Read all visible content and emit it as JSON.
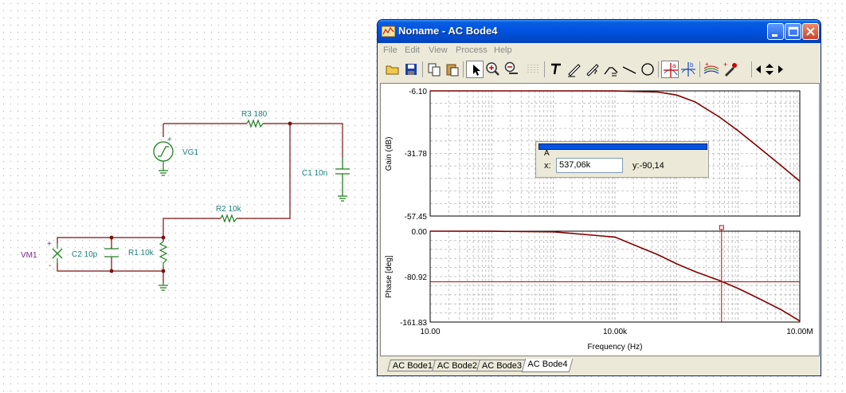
{
  "schematic": {
    "source_label": "VG1",
    "r3_label": "R3 180",
    "r2_label": "R2 10k",
    "r1_label": "R1 10k",
    "c1_label": "C1 10n",
    "c2_label": "C2 10p",
    "meter_label": "VM1",
    "plus_sign": "+",
    "minus_sign": "-"
  },
  "window": {
    "title": "Noname - AC Bode4",
    "menu": [
      "File",
      "Edit",
      "View",
      "Process",
      "Help"
    ]
  },
  "toolbar": {
    "icons": [
      "open-icon",
      "save-icon",
      "copy-icon",
      "paste-icon",
      "pointer-icon",
      "zoom-in-icon",
      "zoom-100-icon",
      "grid-icon",
      "text-icon",
      "pen-icon",
      "pen-help-icon",
      "curve-icon",
      "line-icon",
      "circle-icon",
      "cursor-a-icon",
      "cursor-b-icon",
      "multi-curve-icon",
      "marker-icon",
      "arrow-left-icon",
      "arrow-updown-icon",
      "arrow-right-icon"
    ]
  },
  "cursor": {
    "group_label": "A",
    "x_label": "x:",
    "x_value": "537,06k",
    "y_label": "y:",
    "y_value": "-90,14"
  },
  "tabs": [
    "AC Bode1",
    "AC Bode2",
    "AC Bode3",
    "AC Bode4"
  ],
  "active_tab": "AC Bode4",
  "colors": {
    "curve": "#800000",
    "cursor_line": "#cc0000",
    "grid": "#b8b8b8",
    "schematic_wire": "#7a1010",
    "schematic_component": "#1f7f1f"
  },
  "chart_data": [
    {
      "type": "line",
      "ylabel": "Gain (dB)",
      "x_scale": "log",
      "xlim": [
        10,
        10000000
      ],
      "ylim": [
        -57.45,
        -6.1
      ],
      "ytick_labels": [
        "-6.10",
        "-31.78",
        "-57.45"
      ],
      "grid": true,
      "x": [
        10,
        100,
        1000,
        10000,
        50000,
        100000,
        200000,
        500000,
        1000000,
        2000000,
        5000000,
        10000000
      ],
      "series": [
        {
          "values": [
            -6.1,
            -6.1,
            -6.1,
            -6.12,
            -6.6,
            -7.8,
            -10.6,
            -16.9,
            -22.5,
            -28.6,
            -36.8,
            -43.2
          ]
        }
      ]
    },
    {
      "type": "line",
      "xlabel": "Frequency (Hz)",
      "ylabel": "Phase [deg]",
      "x_scale": "log",
      "xlim": [
        10,
        10000000
      ],
      "ylim": [
        -161.83,
        0
      ],
      "ytick_labels": [
        "0.00",
        "-80.92",
        "-161.83"
      ],
      "xtick_labels": [
        "10.00",
        "10.00k",
        "10.00M"
      ],
      "grid": true,
      "x": [
        10,
        100,
        1000,
        10000,
        50000,
        100000,
        200000,
        500000,
        1000000,
        2000000,
        5000000,
        10000000
      ],
      "series": [
        {
          "values": [
            0,
            -0.1,
            -1.1,
            -10.5,
            -42,
            -58,
            -72,
            -88,
            -102,
            -118,
            -140,
            -160
          ]
        }
      ],
      "cursor": {
        "x": 537060,
        "y": -90.14
      }
    }
  ]
}
